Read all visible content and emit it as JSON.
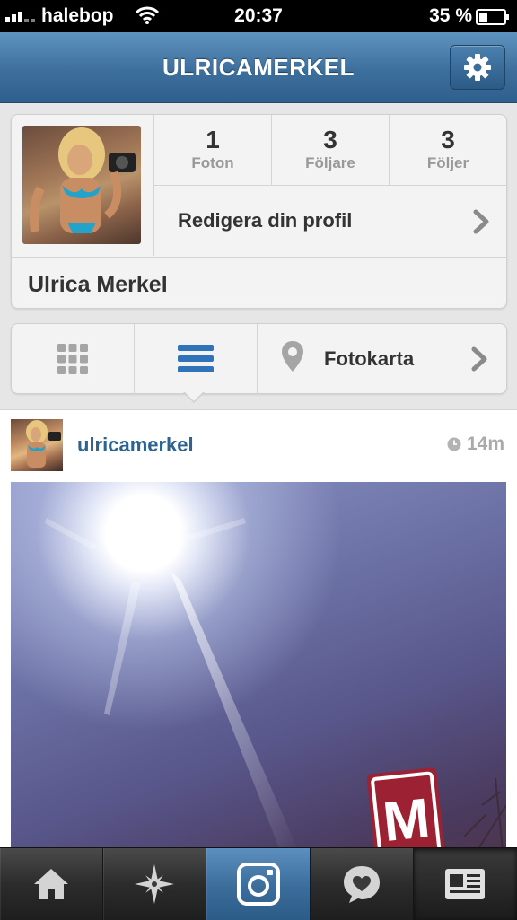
{
  "status_bar": {
    "carrier": "halebop",
    "time": "20:37",
    "battery": "35 %",
    "battery_level": 0.35,
    "icons": [
      "signal-icon",
      "wifi-icon",
      "battery-icon"
    ]
  },
  "nav": {
    "title": "ULRICAMERKEL",
    "settings_icon": "gear-icon"
  },
  "profile": {
    "stats": [
      {
        "value": "1",
        "label": "Foton"
      },
      {
        "value": "3",
        "label": "Följare"
      },
      {
        "value": "3",
        "label": "Följer"
      }
    ],
    "edit_label": "Redigera din profil",
    "full_name": "Ulrica Merkel"
  },
  "view_tabs": {
    "grid_icon": "grid-view-icon",
    "list_icon": "list-view-icon",
    "map_icon": "map-pin-icon",
    "map_label": "Fotokarta",
    "active": "list"
  },
  "post": {
    "username": "ulricamerkel",
    "time": "14m",
    "photo_sign_letter": "M"
  },
  "tab_bar": {
    "items": [
      {
        "icon": "home-icon"
      },
      {
        "icon": "explore-icon"
      },
      {
        "icon": "camera-icon"
      },
      {
        "icon": "news-heart-icon"
      },
      {
        "icon": "profile-icon"
      }
    ]
  },
  "colors": {
    "nav_blue": "#3d6f9d",
    "link_blue": "#2b6391",
    "tab_active_blue": "#3b6d9b"
  }
}
